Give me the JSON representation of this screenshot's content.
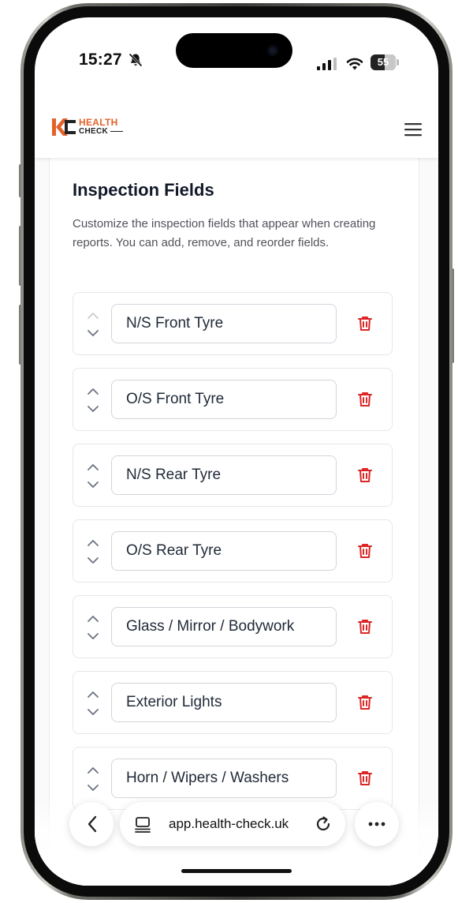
{
  "status_bar": {
    "time": "15:27",
    "battery": "55",
    "battery_level": 0.55
  },
  "header": {
    "logo_top": "HEALTH",
    "logo_bottom": "CHECK",
    "brand_color": "#e4622a"
  },
  "section": {
    "title": "Inspection Fields",
    "description": "Customize the inspection fields that appear when creating reports. You can add, remove, and reorder fields."
  },
  "fields": [
    {
      "label": "N/S Front Tyre"
    },
    {
      "label": "O/S Front Tyre"
    },
    {
      "label": "N/S Rear Tyre"
    },
    {
      "label": "O/S Rear Tyre"
    },
    {
      "label": "Glass / Mirror / Bodywork"
    },
    {
      "label": "Exterior Lights"
    },
    {
      "label": "Horn / Wipers / Washers"
    }
  ],
  "browser": {
    "url": "app.health-check.uk"
  },
  "colors": {
    "delete": "#dc2626",
    "arrow": "#6b7280"
  }
}
